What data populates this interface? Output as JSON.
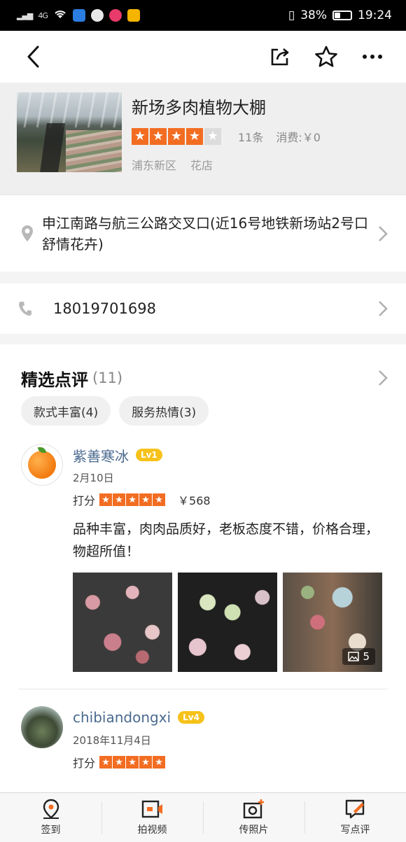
{
  "status_bar": {
    "signal_left": "4G",
    "battery": "38%",
    "battery_level": 0.38,
    "time": "19:24"
  },
  "nav": {
    "icons": [
      "back-icon",
      "share-icon",
      "favorite-star-icon",
      "more-icon"
    ]
  },
  "shop": {
    "name": "新场多肉植物大棚",
    "rating_stars": 4,
    "review_count": "11条",
    "cost": "消费:￥0",
    "district": "浦东新区",
    "category": "花店"
  },
  "address": {
    "text": "申江南路与航三公路交叉口(近16号地铁新场站2号口舒情花卉)"
  },
  "phone": {
    "number": "18019701698"
  },
  "reviews_section": {
    "title": "精选点评",
    "count": "(11)",
    "tags": [
      "款式丰富(4)",
      "服务热情(3)"
    ],
    "items": [
      {
        "user": "紫善寒冰",
        "level": "Lv1",
        "date": "2月10日",
        "score_label": "打分",
        "stars": 5,
        "price": "￥568",
        "text": "品种丰富，肉肉品质好，老板态度不错，价格合理，物超所值！",
        "photo_count": "5"
      },
      {
        "user": "chibiandongxi",
        "level": "Lv4",
        "date": "2018年11月4日",
        "score_label": "打分",
        "stars": 5
      }
    ]
  },
  "tabbar": {
    "items": [
      {
        "label": "签到",
        "icon": "location-pin-icon"
      },
      {
        "label": "拍视频",
        "icon": "video-camera-icon"
      },
      {
        "label": "传照片",
        "icon": "photo-upload-icon"
      },
      {
        "label": "写点评",
        "icon": "write-review-icon"
      }
    ]
  }
}
